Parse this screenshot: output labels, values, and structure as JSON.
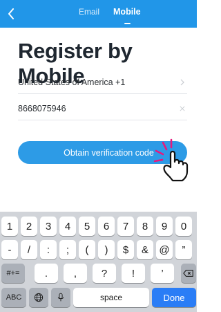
{
  "header": {
    "tabs": [
      {
        "label": "Email",
        "active": false
      },
      {
        "label": "Mobile",
        "active": true
      }
    ],
    "background": "#2196e8"
  },
  "page": {
    "title": "Register by Mobile"
  },
  "form": {
    "country_value": "United States of America +1",
    "phone_value": "8668075946",
    "obtain_code_label": "Obtain verification code",
    "accent": "#2d9be6"
  },
  "keyboard": {
    "row1": [
      "1",
      "2",
      "3",
      "4",
      "5",
      "6",
      "7",
      "8",
      "9",
      "0"
    ],
    "row2": [
      "-",
      "/",
      ":",
      ";",
      "(",
      ")",
      "$",
      "&",
      "@",
      "”"
    ],
    "row3_mode": "#+=",
    "row3": [
      ".",
      ",",
      "?",
      "!",
      "’"
    ],
    "abc_label": "ABC",
    "space_label": "space",
    "done_label": "Done",
    "done_color": "#2a7df6"
  }
}
